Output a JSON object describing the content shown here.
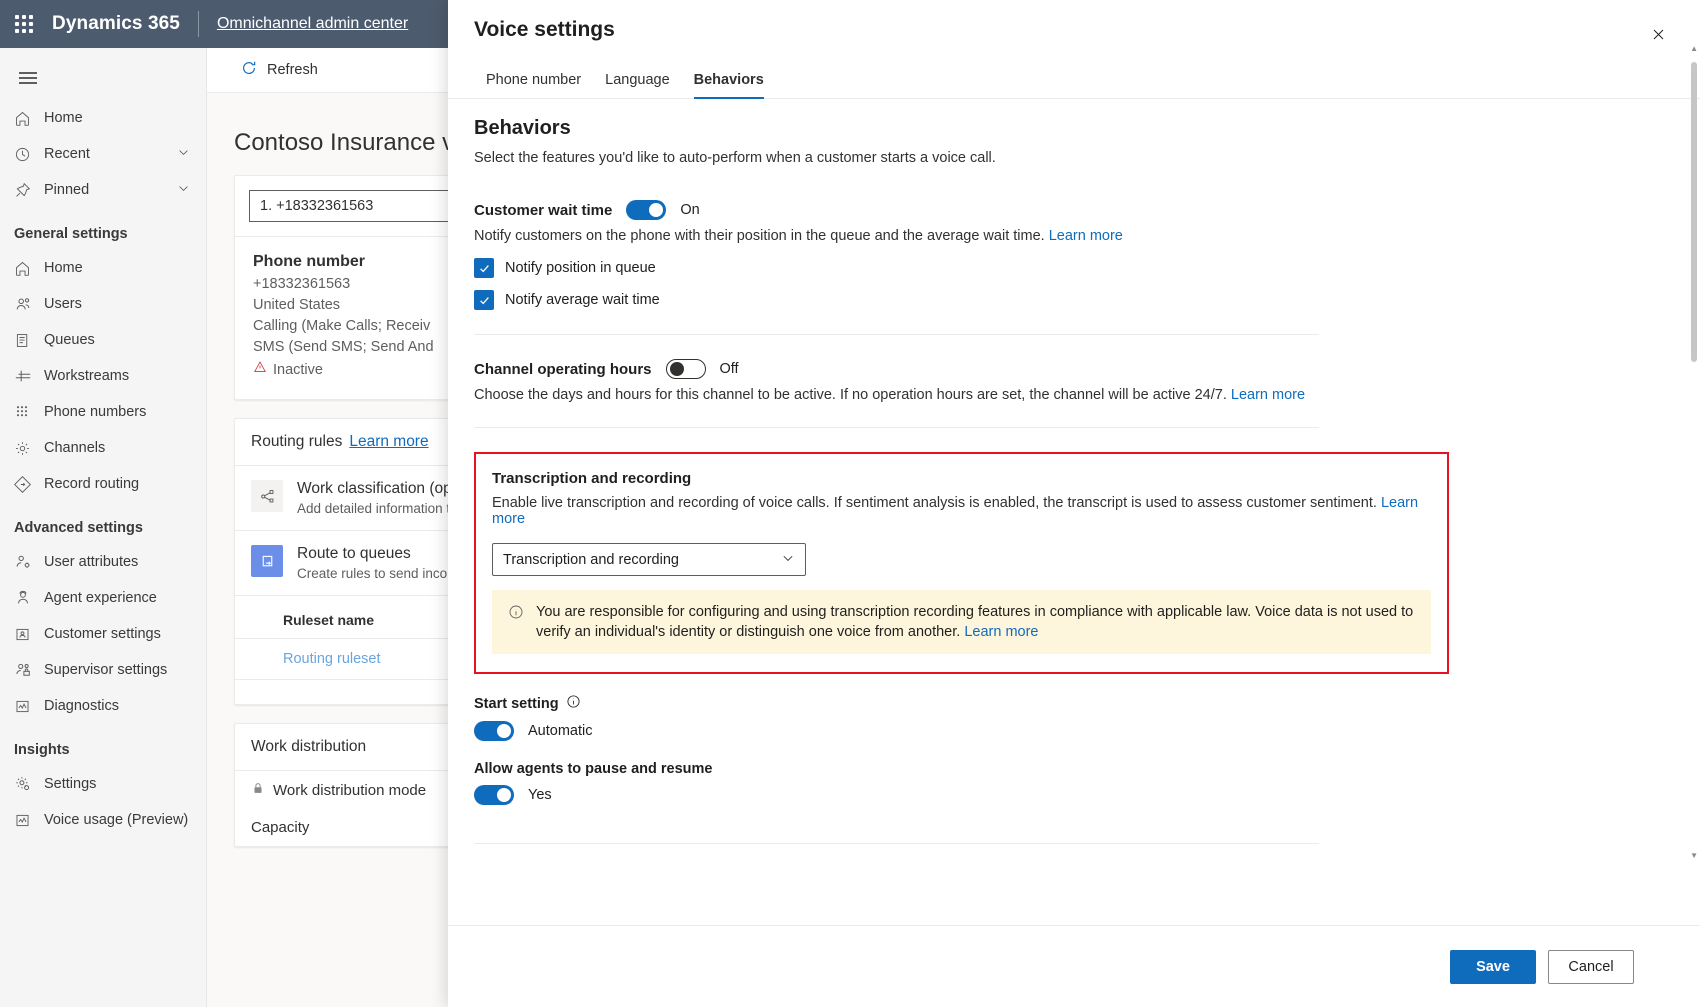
{
  "appbar": {
    "waffle_icon": "waffle-grid-icon",
    "brand": "Dynamics 365",
    "app_name": "Omnichannel admin center"
  },
  "sidebar": {
    "hamburger_icon": "hamburger-icon",
    "top_items": [
      {
        "label": "Home",
        "icon": "home-icon",
        "chevron": false
      },
      {
        "label": "Recent",
        "icon": "clock-icon",
        "chevron": true
      },
      {
        "label": "Pinned",
        "icon": "pin-icon",
        "chevron": true
      }
    ],
    "groups": [
      {
        "title": "General settings",
        "items": [
          {
            "label": "Home",
            "icon": "home-icon"
          },
          {
            "label": "Users",
            "icon": "users-icon"
          },
          {
            "label": "Queues",
            "icon": "queues-icon"
          },
          {
            "label": "Workstreams",
            "icon": "workstreams-icon"
          },
          {
            "label": "Phone numbers",
            "icon": "dialpad-icon"
          },
          {
            "label": "Channels",
            "icon": "gear-icon"
          },
          {
            "label": "Record routing",
            "icon": "record-routing-icon"
          }
        ]
      },
      {
        "title": "Advanced settings",
        "items": [
          {
            "label": "User attributes",
            "icon": "user-attributes-icon"
          },
          {
            "label": "Agent experience",
            "icon": "agent-icon"
          },
          {
            "label": "Customer settings",
            "icon": "customer-card-icon"
          },
          {
            "label": "Supervisor settings",
            "icon": "supervisor-icon"
          },
          {
            "label": "Diagnostics",
            "icon": "diagnostics-chart-icon"
          }
        ]
      },
      {
        "title": "Insights",
        "items": [
          {
            "label": "Settings",
            "icon": "gear-insights-icon"
          },
          {
            "label": "Voice usage (Preview)",
            "icon": "voice-usage-chart-icon"
          }
        ]
      }
    ]
  },
  "main": {
    "command_bar": {
      "refresh_label": "Refresh",
      "refresh_icon": "refresh-icon"
    },
    "page_title": "Contoso Insurance voi",
    "phone_card": {
      "selected_number": "1. +18332361563",
      "dropdown_icon": "chevron-down-icon",
      "heading": "Phone number",
      "number": "+18332361563",
      "country": "United States",
      "calling": "Calling (Make Calls; Receiv",
      "sms": "SMS (Send SMS; Send And",
      "status": "Inactive",
      "status_icon": "warning-triangle-icon"
    },
    "routing_card": {
      "title": "Routing rules",
      "learn_more": "Learn more",
      "rows": [
        {
          "title": "Work classification (opti",
          "subtitle": "Add detailed information to",
          "icon": "work-classification-icon"
        },
        {
          "title": "Route to queues",
          "subtitle": "Create rules to send incom",
          "icon": "route-to-queues-icon"
        }
      ],
      "table_header": "Ruleset name",
      "table_rows": [
        "Routing ruleset"
      ]
    },
    "work_distribution_card": {
      "title": "Work distribution",
      "mode_label": "Work distribution mode",
      "mode_icon": "lock-icon",
      "capacity_label": "Capacity"
    }
  },
  "panel": {
    "title": "Voice settings",
    "close_icon": "close-icon",
    "tabs": [
      {
        "label": "Phone number",
        "active": false
      },
      {
        "label": "Language",
        "active": false
      },
      {
        "label": "Behaviors",
        "active": true
      }
    ],
    "section": {
      "heading": "Behaviors",
      "description": "Select the features you'd like to auto-perform when a customer starts a voice call."
    },
    "customer_wait_time": {
      "label": "Customer wait time",
      "state": "On",
      "toggle_on": true,
      "help": "Notify customers on the phone with their position in the queue and the average wait time.",
      "learn_more": "Learn more",
      "checkboxes": [
        {
          "label": "Notify position in queue",
          "checked": true
        },
        {
          "label": "Notify average wait time",
          "checked": true
        }
      ]
    },
    "channel_operating_hours": {
      "label": "Channel operating hours",
      "state": "Off",
      "toggle_on": false,
      "help": "Choose the days and hours for this channel to be active. If no operation hours are set, the channel will be active 24/7.",
      "learn_more": "Learn more"
    },
    "transcription": {
      "heading": "Transcription and recording",
      "help": "Enable live transcription and recording of voice calls. If sentiment analysis is enabled, the transcript is used to assess customer sentiment.",
      "learn_more": "Learn more",
      "dropdown_value": "Transcription and recording",
      "dropdown_icon": "chevron-down-icon",
      "banner_icon": "info-icon",
      "banner_text": "You are responsible for configuring and using transcription recording features in compliance with applicable law. Voice data is not used to verify an individual's identity or distinguish one voice from another.",
      "banner_learn_more": "Learn more",
      "highlight_color": "#e81123"
    },
    "start_setting": {
      "label": "Start setting",
      "info_icon": "info-circle-icon",
      "state": "Automatic",
      "toggle_on": true
    },
    "allow_pause_resume": {
      "label": "Allow agents to pause and resume",
      "state": "Yes",
      "toggle_on": true
    },
    "footer": {
      "save_label": "Save",
      "cancel_label": "Cancel"
    }
  },
  "colors": {
    "appbar_bg": "#4d5b6e",
    "accent": "#0f6cbd",
    "highlight": "#e81123",
    "banner_bg": "#fdf6dd"
  }
}
